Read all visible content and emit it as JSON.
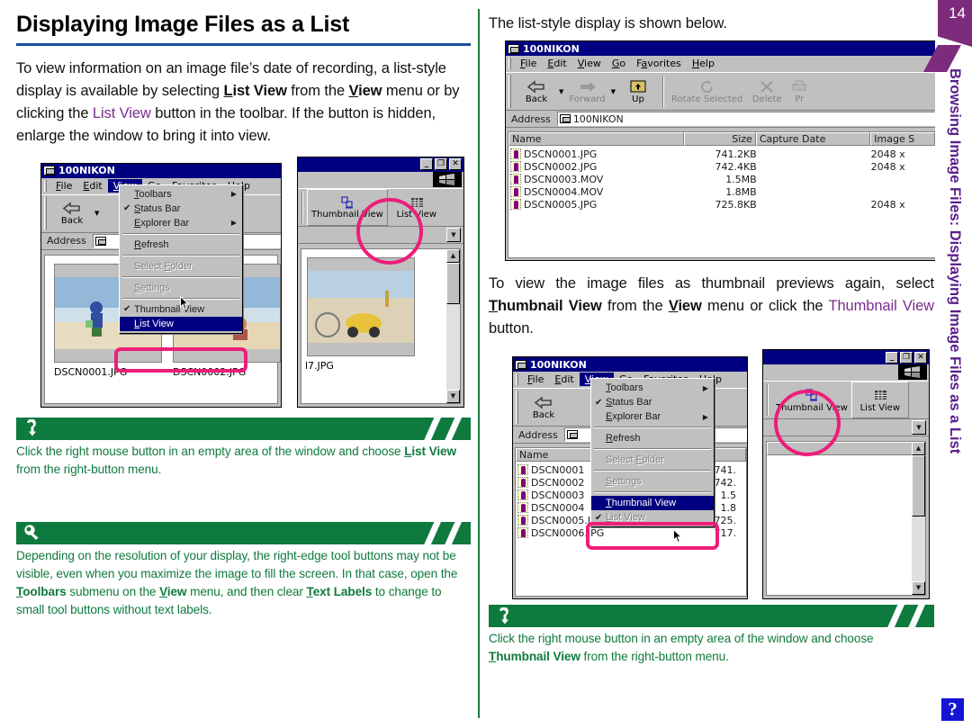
{
  "page": {
    "number": "14",
    "side_tab_text": "Browsing Image Files: Displaying Image Files as a List",
    "help_badge": "?"
  },
  "left": {
    "title": "Displaying Image Files as a List",
    "intro_parts": {
      "p1": "To view information on an image file’s date of recording, a list-style display is available by selecting ",
      "listview_bold": "List View",
      "p2": " from the ",
      "view_bold": "View",
      "p3": " menu or by clicking the ",
      "listview_purple": "List View",
      "p4": " button in the toolbar.  If the button is hidden, enlarge the window to bring it into view."
    },
    "note1": {
      "icon": "right-click-icon",
      "text_p1": "Click the right mouse button in an empty area of the window and choose ",
      "text_bold": "List View",
      "text_p2": " from the right-button menu."
    },
    "note2": {
      "icon": "lightbulb-tip-icon",
      "text_p1": "Depending on the resolution of your display, the right-edge tool buttons may not be visible, even when you maximize the image to fill the screen.  In that case, open the ",
      "bold1": "Toolbars",
      "text_p2": " submenu on the ",
      "bold2": "View",
      "text_p3": " menu, and then clear ",
      "bold3": "Text Labels",
      "text_p4": " to change to small tool buttons without text labels."
    }
  },
  "right": {
    "lead_text": "The list-style display is shown below.",
    "mid_text": {
      "p1": "To view the image files as thumbnail previews again, select ",
      "bold1": "Thumbnail View",
      "p2": " from the ",
      "bold2": "View",
      "p3": " menu or click the ",
      "purple1": "Thumbnail View",
      "p4": " button."
    },
    "note3": {
      "icon": "right-click-icon",
      "text_p1": "Click the right mouse button in an empty area of the window and choose ",
      "text_bold": "Thumbnail View",
      "text_p2": " from the right-button menu."
    }
  },
  "explorer": {
    "title": "100NIKON",
    "title_icon": "folder-window-icon",
    "menus": [
      "File",
      "Edit",
      "View",
      "Go",
      "Favorites",
      "Help"
    ],
    "toolbar": {
      "back": "Back",
      "forward": "Forward",
      "up": "Up",
      "rotate_selected": "Rotate Selected",
      "delete": "Delete",
      "print": "Pr",
      "thumbnail_view": "Thumbnail View",
      "list_view": "List View"
    },
    "address_label": "Address",
    "address_value": "100NIKON",
    "columns": [
      "Name",
      "Size",
      "Capture Date",
      "Image S"
    ],
    "rows": [
      {
        "name": "DSCN0001.JPG",
        "size": "741.2KB",
        "capture_date": "",
        "image_size": "2048 x"
      },
      {
        "name": "DSCN0002.JPG",
        "size": "742.4KB",
        "capture_date": "",
        "image_size": "2048 x"
      },
      {
        "name": "DSCN0003.MOV",
        "size": "1.5MB",
        "capture_date": "",
        "image_size": ""
      },
      {
        "name": "DSCN0004.MOV",
        "size": "1.8MB",
        "capture_date": "",
        "image_size": ""
      },
      {
        "name": "DSCN0005.JPG",
        "size": "725.8KB",
        "capture_date": "",
        "image_size": "2048 x"
      }
    ],
    "rows_truncated": [
      {
        "name": "DSCN0001",
        "size": "741."
      },
      {
        "name": "DSCN0002",
        "size": "742."
      },
      {
        "name": "DSCN0003",
        "size": "1.5"
      },
      {
        "name": "DSCN0004",
        "size": "1.8"
      },
      {
        "name": "DSCN0005.JPG",
        "size": "725."
      },
      {
        "name": "DSCN0006.JPG",
        "size": "717."
      }
    ],
    "view_menu": {
      "toolbars": "Toolbars",
      "status_bar": "Status Bar",
      "explorer_bar": "Explorer Bar",
      "refresh": "Refresh",
      "select_folder": "Select Folder",
      "settings": "Settings",
      "thumbnail_view": "Thumbnail View",
      "list_view": "List View",
      "checkmark": "✔",
      "submenu_arrow": "▶"
    },
    "thumbnails": [
      {
        "caption": "DSCN0001.JPG"
      },
      {
        "caption": "DSCN0002.JPG"
      },
      {
        "caption": "l7.JPG"
      }
    ]
  },
  "colors": {
    "accent_rule": "#1a4f9c",
    "note_green": "#0f7a3d",
    "purple_link": "#7b2d8e",
    "highlight_pink": "#ec1e79",
    "tab_purple": "#7d2b7d",
    "help_blue": "#1414d2",
    "win_titlebar": "#000080"
  }
}
